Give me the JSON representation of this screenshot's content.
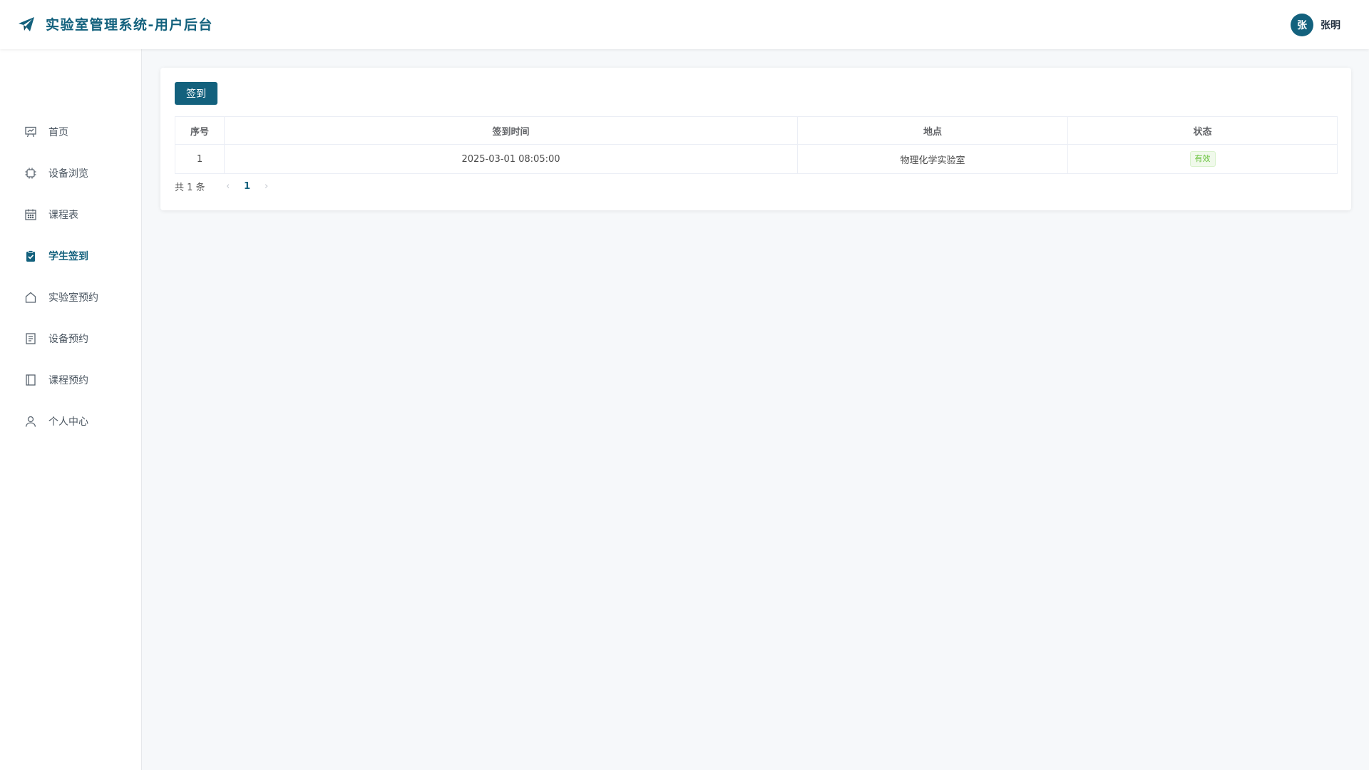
{
  "header": {
    "title": "实验室管理系统-用户后台",
    "user_avatar": "张",
    "user_name": "张明",
    "accent": "#13617d"
  },
  "sidebar": {
    "items": [
      {
        "label": "首页",
        "icon": "presentation-icon"
      },
      {
        "label": "设备浏览",
        "icon": "chip-icon"
      },
      {
        "label": "课程表",
        "icon": "calendar-icon"
      },
      {
        "label": "学生签到",
        "icon": "clipboard-check-icon",
        "active": true
      },
      {
        "label": "实验室预约",
        "icon": "house-icon"
      },
      {
        "label": "设备预约",
        "icon": "document-icon"
      },
      {
        "label": "课程预约",
        "icon": "notebook-icon"
      },
      {
        "label": "个人中心",
        "icon": "user-icon"
      }
    ]
  },
  "main": {
    "signin_button": "签到",
    "table": {
      "columns": [
        "序号",
        "签到时间",
        "地点",
        "状态"
      ],
      "rows": [
        {
          "index": "1",
          "time": "2025-03-01 08:05:00",
          "location": "物理化学实验室",
          "status": "有效"
        }
      ]
    },
    "pagination": {
      "total": "共 1 条",
      "current_page": "1"
    }
  },
  "colors": {
    "status_ok": "#67c23a",
    "background": "#f6f8fa"
  }
}
